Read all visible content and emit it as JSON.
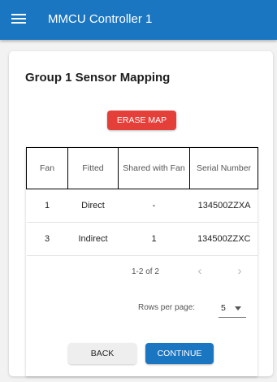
{
  "appbar": {
    "title": "MMCU Controller 1",
    "menu_icon": "hamburger-menu-icon",
    "color": "#1b76c2"
  },
  "card": {
    "title": "Group 1 Sensor Mapping",
    "erase_label": "ERASE MAP",
    "erase_color": "#e53f3a"
  },
  "table": {
    "columns": [
      "Fan",
      "Fitted",
      "Shared with Fan",
      "Serial Number"
    ],
    "rows": [
      [
        "1",
        "Direct",
        "-",
        "134500ZZXA"
      ],
      [
        "3",
        "Indirect",
        "1",
        "134500ZZXC"
      ]
    ]
  },
  "pagination": {
    "range": "1-2 of 2",
    "prev_icon": "chevron-left-icon",
    "next_icon": "chevron-right-icon",
    "rows_per_page_label": "Rows per page:",
    "rows_per_page_value": "5"
  },
  "footer": {
    "back_label": "BACK",
    "continue_label": "CONTINUE"
  }
}
